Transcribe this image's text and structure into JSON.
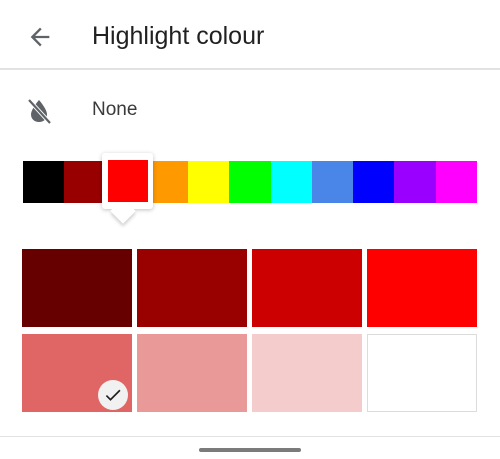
{
  "header": {
    "title": "Highlight colour",
    "back_icon": "arrow-left-icon"
  },
  "none_option": {
    "label": "None",
    "icon": "no-highlight-icon"
  },
  "hue_strip": {
    "selected_index": 2,
    "colors": [
      "#000000",
      "#980000",
      "#ff0000",
      "#ff9900",
      "#ffff00",
      "#00ff00",
      "#00ffff",
      "#4a86e8",
      "#0000ff",
      "#9900ff",
      "#ff00ff"
    ]
  },
  "shades": {
    "selected_index": 4,
    "colors": [
      "#660000",
      "#990000",
      "#cc0000",
      "#ff0000",
      "#e06666",
      "#ea9999",
      "#f4cccc",
      "#ffffff"
    ]
  }
}
